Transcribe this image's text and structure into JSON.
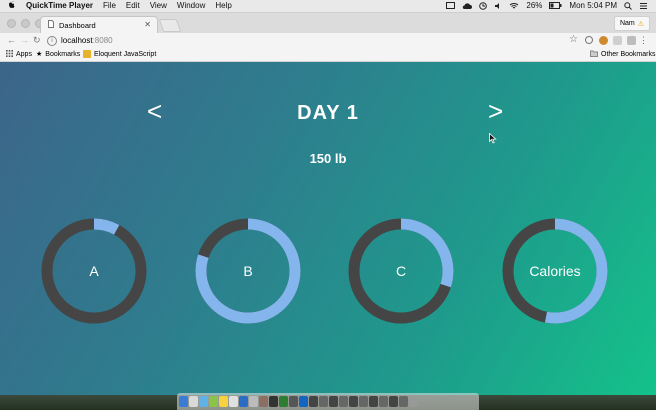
{
  "menubar": {
    "app_name": "QuickTime Player",
    "menus": [
      "File",
      "Edit",
      "View",
      "Window",
      "Help"
    ],
    "battery": "26%",
    "clock": "Mon 5:04 PM"
  },
  "browser": {
    "tab_title": "Dashboard",
    "profile_name": "Nam",
    "url_host": "localhost",
    "url_port": ":8080",
    "bookmarks": {
      "apps": "Apps",
      "bookmarks": "Bookmarks",
      "eloquent": "Eloquent JavaScript",
      "other": "Other Bookmarks"
    }
  },
  "dashboard": {
    "prev_arrow": "<",
    "next_arrow": ">",
    "day_title": "DAY 1",
    "weight": "150 lb",
    "rings": [
      {
        "label": "A",
        "fraction": 0.08
      },
      {
        "label": "B",
        "fraction": 0.8
      },
      {
        "label": "C",
        "fraction": 0.3
      },
      {
        "label": "Calories",
        "fraction": 0.53
      }
    ]
  },
  "colors": {
    "ring_track": "#454545",
    "ring_fill": "#84b5ec",
    "gradient_start": "#3c6589",
    "gradient_end": "#14c28a"
  }
}
